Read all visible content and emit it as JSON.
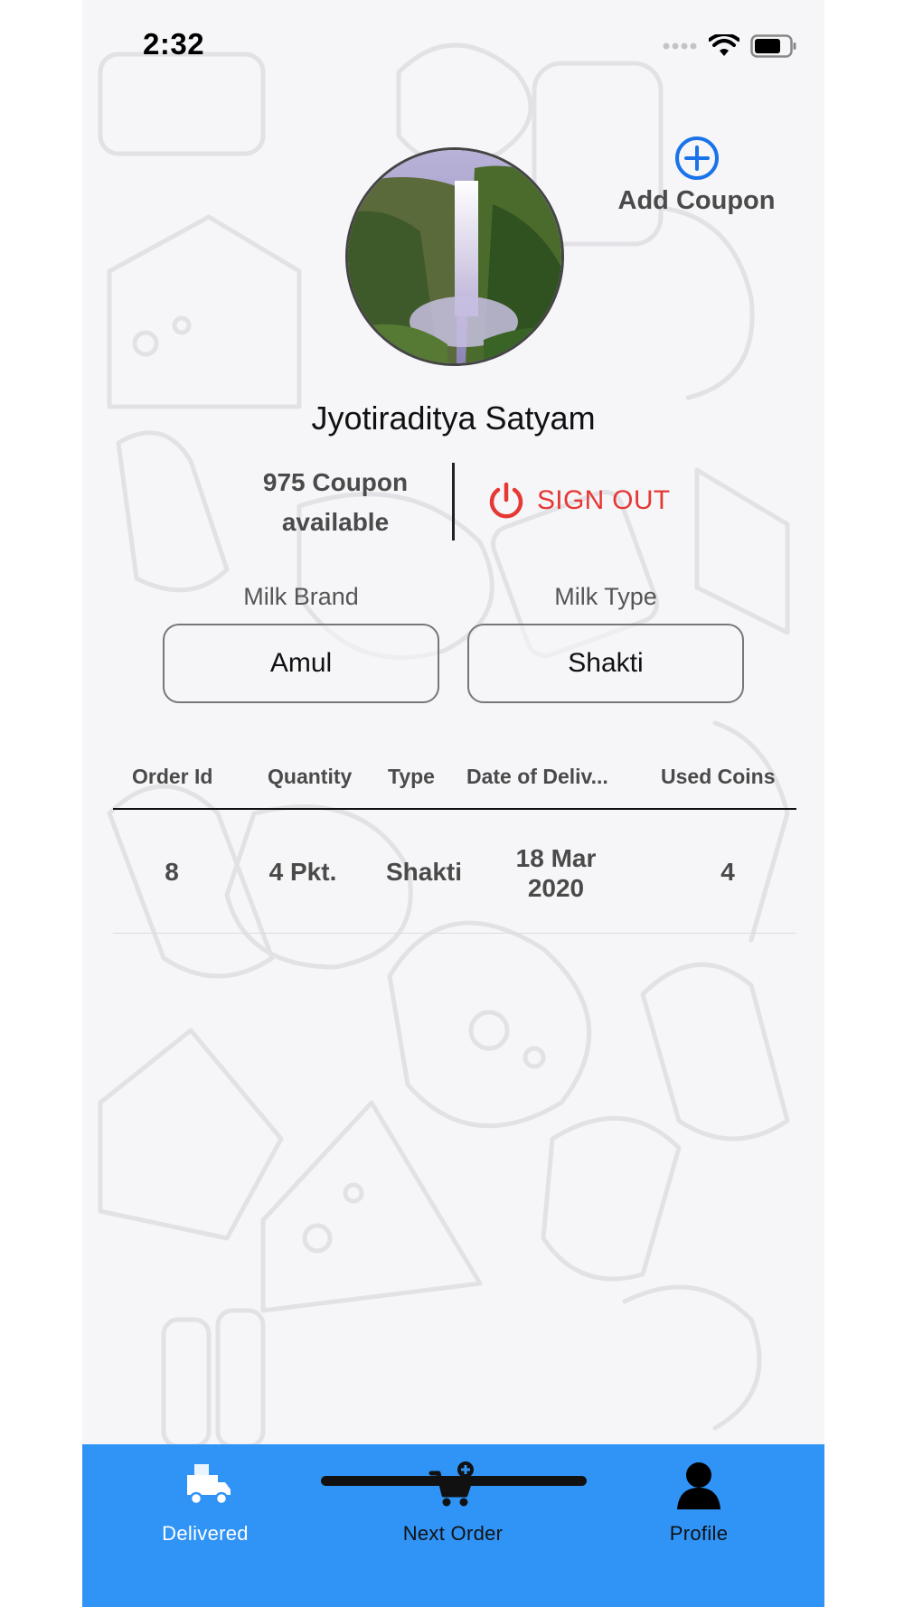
{
  "status_bar": {
    "time": "2:32"
  },
  "add_coupon": {
    "label": "Add Coupon"
  },
  "profile": {
    "name": "Jyotiraditya Satyam",
    "coupon_count_line1": "975 Coupon",
    "coupon_count_line2": "available",
    "sign_out_label": "SIGN OUT"
  },
  "milk_brand": {
    "label": "Milk Brand",
    "value": "Amul"
  },
  "milk_type": {
    "label": "Milk Type",
    "value": "Shakti"
  },
  "orders_table": {
    "columns": [
      "Order Id",
      "Quantity",
      "Type",
      "Date of Deliv...",
      "Used Coins"
    ],
    "rows": [
      {
        "order_id": "8",
        "quantity": "4 Pkt.",
        "type": "Shakti",
        "date_line1": "18 Mar",
        "date_line2": "2020",
        "used_coins": "4"
      }
    ]
  },
  "bottom_nav": {
    "items": [
      {
        "label": "Delivered",
        "icon": "delivery-truck-icon",
        "active": true
      },
      {
        "label": "Next Order",
        "icon": "cart-add-icon",
        "active": false
      },
      {
        "label": "Profile",
        "icon": "person-icon",
        "active": false
      }
    ],
    "background_color": "#3093f6",
    "active_label_color": "#ffffff",
    "inactive_label_color": "#111111"
  },
  "colors": {
    "accent": "#1a73e8",
    "danger": "#e53935",
    "background": "#f6f6f9"
  }
}
